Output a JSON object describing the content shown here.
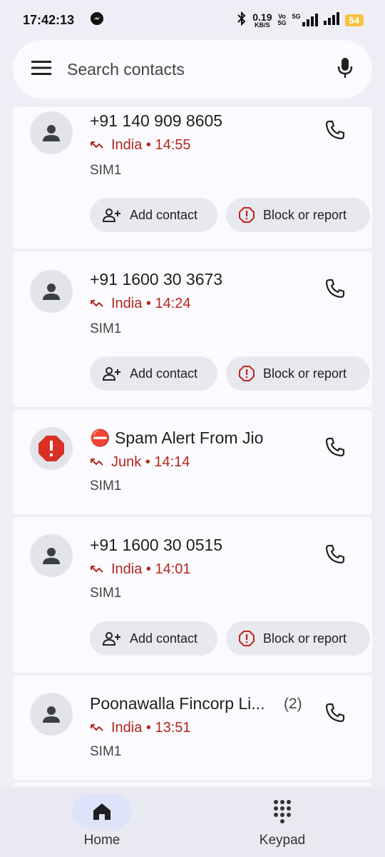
{
  "status_bar": {
    "time": "17:42:13",
    "speed_value": "0.19",
    "speed_unit": "KB/S",
    "volte_top": "Vo",
    "volte_bottom": "5G",
    "network": "5G",
    "battery": "54"
  },
  "search": {
    "placeholder": "Search contacts"
  },
  "calls": [
    {
      "title": "+91 140 909 8605",
      "detail": "India • 14:55",
      "sim": "SIM1",
      "actions": {
        "add": "Add contact",
        "block": "Block or report"
      }
    },
    {
      "title": "+91 1600 30 3673",
      "detail": "India • 14:24",
      "sim": "SIM1",
      "actions": {
        "add": "Add contact",
        "block": "Block or report"
      }
    },
    {
      "title": "⛔ Spam Alert From Jio",
      "detail": "Junk • 14:14",
      "sim": "SIM1"
    },
    {
      "title": "+91 1600 30 0515",
      "detail": "India • 14:01",
      "sim": "SIM1",
      "actions": {
        "add": "Add contact",
        "block": "Block or report"
      }
    },
    {
      "title": "Poonawalla Fincorp Li...",
      "count": "(2)",
      "detail": "India • 13:51",
      "sim": "SIM1"
    }
  ],
  "nav": {
    "home": "Home",
    "keypad": "Keypad"
  },
  "colors": {
    "missed": "#b3261e",
    "spam_badge": "#d93025",
    "active_pill": "#dde3f8"
  }
}
